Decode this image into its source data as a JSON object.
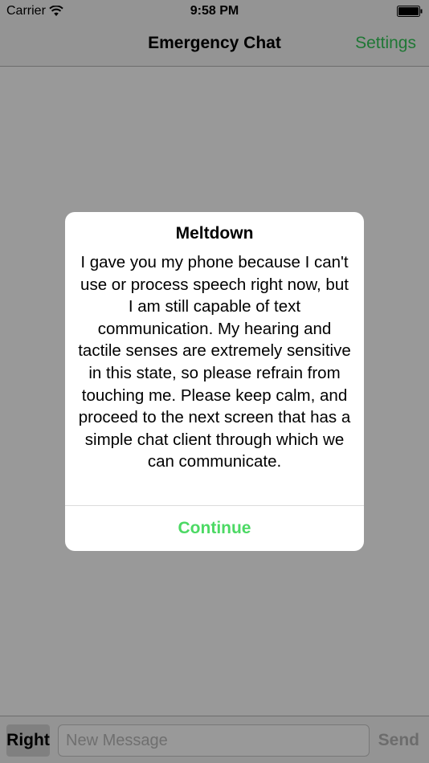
{
  "status_bar": {
    "carrier": "Carrier",
    "time": "9:58 PM"
  },
  "nav": {
    "title": "Emergency Chat",
    "settings_label": "Settings"
  },
  "input_bar": {
    "right_label": "Right",
    "message_placeholder": "New Message",
    "send_label": "Send"
  },
  "alert": {
    "title": "Meltdown",
    "message": "I gave you my phone because I can't use or process speech right now, but I am still capable of text communication. My hearing and tactile senses are extremely sensitive in this state, so please refrain from touching me. Please keep calm, and proceed to the next screen that has a simple chat client through which we can communicate.",
    "button_label": "Continue"
  },
  "colors": {
    "accent": "#35c759",
    "button_green": "#4cd964"
  },
  "icons": [
    "wifi-icon",
    "battery-icon"
  ]
}
